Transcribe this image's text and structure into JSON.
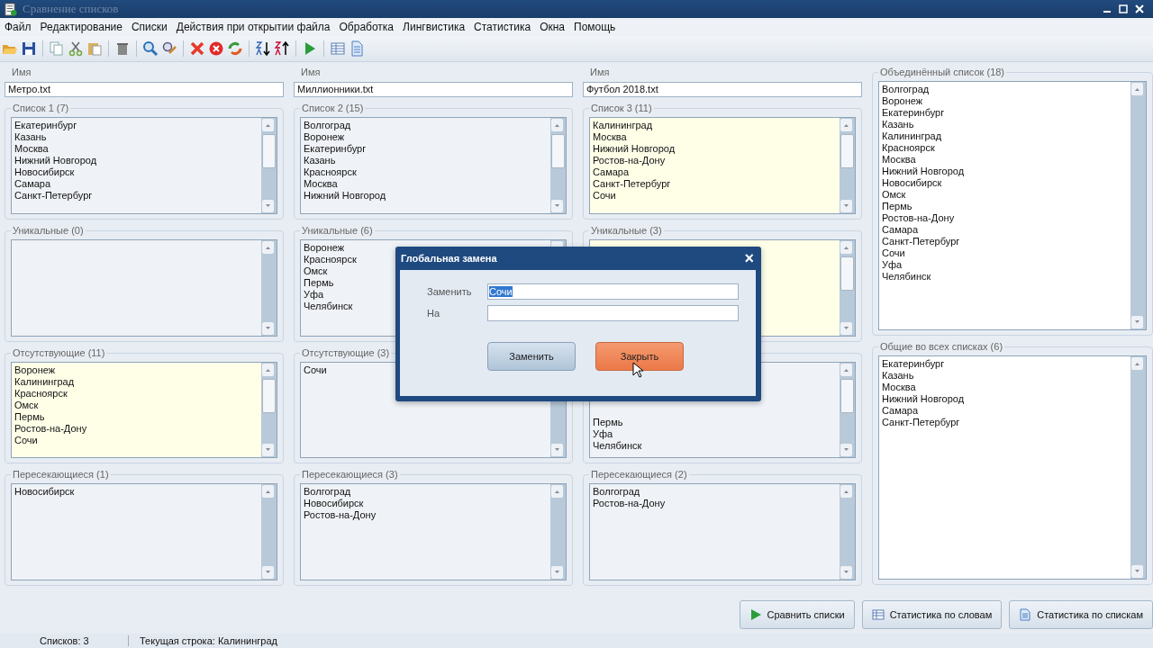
{
  "window": {
    "title": "Сравнение списков"
  },
  "menu": [
    "Файл",
    "Редактирование",
    "Списки",
    "Действия при открытии файла",
    "Обработка",
    "Лингвистика",
    "Статистика",
    "Окна",
    "Помощь"
  ],
  "columns": [
    {
      "name_label": "Имя",
      "file": "Метро.txt",
      "groups": [
        {
          "title": "Список 1 (7)",
          "highlighted": false,
          "covered": false,
          "items": [
            "Екатеринбург",
            "Казань",
            "Москва",
            "Нижний Новгород",
            "Новосибирск",
            "Самара",
            "Санкт-Петербург"
          ]
        },
        {
          "title": "Уникальные (0)",
          "highlighted": false,
          "covered": false
        },
        {
          "title": "Отсутствующие (11)",
          "highlighted": true,
          "covered": false,
          "items": [
            "Воронеж",
            "Калининград",
            "Красноярск",
            "Омск",
            "Пермь",
            "Ростов-на-Дону",
            "Сочи"
          ]
        },
        {
          "title": "Пересекающиеся (1)",
          "highlighted": false,
          "covered": false,
          "items": [
            "Новосибирск"
          ]
        }
      ]
    },
    {
      "name_label": "Имя",
      "file": "Миллионники.txt",
      "groups": [
        {
          "title": "Список 2 (15)",
          "highlighted": false,
          "covered": false,
          "items": [
            "Волгоград",
            "Воронеж",
            "Екатеринбург",
            "Казань",
            "Красноярск",
            "Москва",
            "Нижний Новгород"
          ]
        },
        {
          "title": "Уникальные (6)",
          "highlighted": false,
          "covered": false,
          "items": [
            "Воронеж",
            "Красноярск",
            "Омск",
            "Пермь",
            "Уфа",
            "Челябинск"
          ]
        },
        {
          "title": "Отсутствующие (3)",
          "highlighted": false,
          "covered": false,
          "items": [
            "Сочи"
          ]
        },
        {
          "title": "Пересекающиеся (3)",
          "highlighted": false,
          "covered": false,
          "items": [
            "Волгоград",
            "Новосибирск",
            "Ростов-на-Дону"
          ]
        }
      ]
    },
    {
      "name_label": "Имя",
      "file": "Футбол 2018.txt",
      "groups": [
        {
          "title": "Список 3 (11)",
          "highlighted": true,
          "covered": false,
          "items": [
            "Калининград",
            "Москва",
            "Нижний Новгород",
            "Ростов-на-Дону",
            "Самара",
            "Санкт-Петербург",
            "Сочи"
          ]
        },
        {
          "title": "Уникальные (3)",
          "highlighted": true,
          "covered": true
        },
        {
          "highlighted": false,
          "covered": true,
          "items": [
            "Пермь",
            "Уфа",
            "Челябинск"
          ]
        },
        {
          "title": "Пересекающиеся (2)",
          "highlighted": false,
          "covered": false,
          "items": [
            "Волгоград",
            "Ростов-на-Дону"
          ]
        }
      ]
    }
  ],
  "right": [
    {
      "title": "Объединённый список (18)",
      "items": [
        "Волгоград",
        "Воронеж",
        "Екатеринбург",
        "Казань",
        "Калининград",
        "Красноярск",
        "Москва",
        "Нижний Новгород",
        "Новосибирск",
        "Омск",
        "Пермь",
        "Ростов-на-Дону",
        "Самара",
        "Санкт-Петербург",
        "Сочи",
        "Уфа",
        "Челябинск"
      ]
    },
    {
      "title": "Общие во всех списках (6)",
      "items": [
        "Екатеринбург",
        "Казань",
        "Москва",
        "Нижний Новгород",
        "Самара",
        "Санкт-Петербург"
      ]
    }
  ],
  "dialog": {
    "title": "Глобальная замена",
    "close": "×",
    "fields": [
      {
        "label": "Заменить",
        "value": "Сочи",
        "value_selected": true
      },
      {
        "label": "На"
      }
    ],
    "buttons": [
      {
        "label": "Заменить",
        "hovered": false
      },
      {
        "label": "Закрыть",
        "hovered": true
      }
    ]
  },
  "actions": [
    {
      "label": "Сравнить списки",
      "kind": "play"
    },
    {
      "label": "Статистика по словам",
      "kind": "table"
    },
    {
      "label": "Статистика по спискам",
      "kind": "document"
    }
  ],
  "status": [
    "Списков: 3",
    "Текущая строка: Калининград"
  ]
}
